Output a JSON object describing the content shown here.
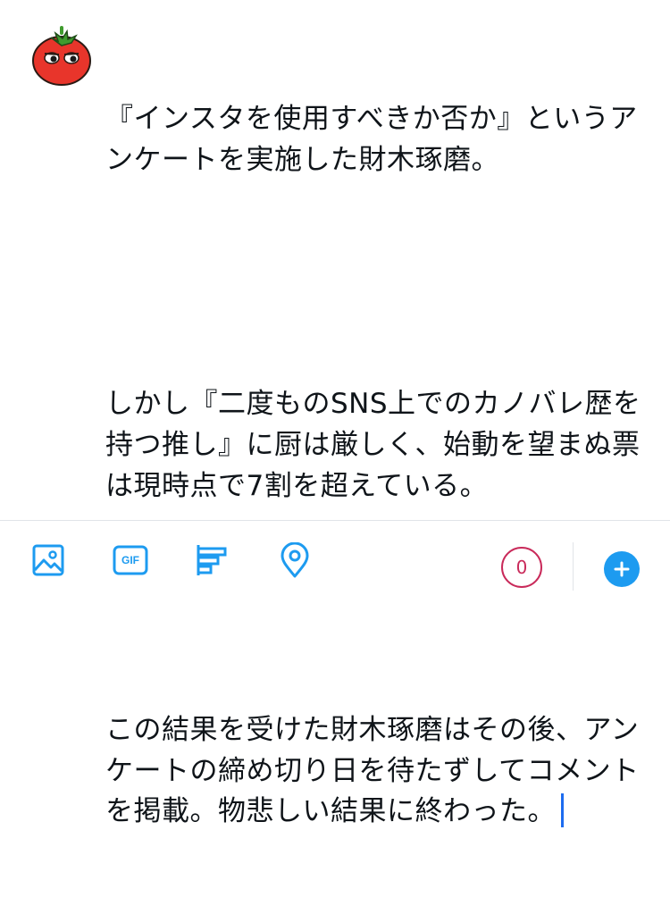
{
  "composer": {
    "avatar_icon": "tomato-avatar-icon",
    "paragraphs": [
      "『インスタを使用すべきか否か』というアンケートを実施した財木琢磨。",
      "しかし『二度ものSNS上でのカノバレ歴を持つ推し』に厨は厳しく、始動を望まぬ票は現時点で7割を超えている。",
      "この結果を受けた財木琢磨はその後、アンケートの締め切り日を待たずしてコメントを掲載。物悲しい結果に終わった。"
    ]
  },
  "toolbar": {
    "icons": [
      "image-icon",
      "gif-icon",
      "poll-icon",
      "location-icon"
    ],
    "gif_label": "GIF",
    "char_counter": "0",
    "add_icon": "plus-icon",
    "colors": {
      "accent": "#1d9bf0",
      "counter": "#c92a5a"
    }
  }
}
